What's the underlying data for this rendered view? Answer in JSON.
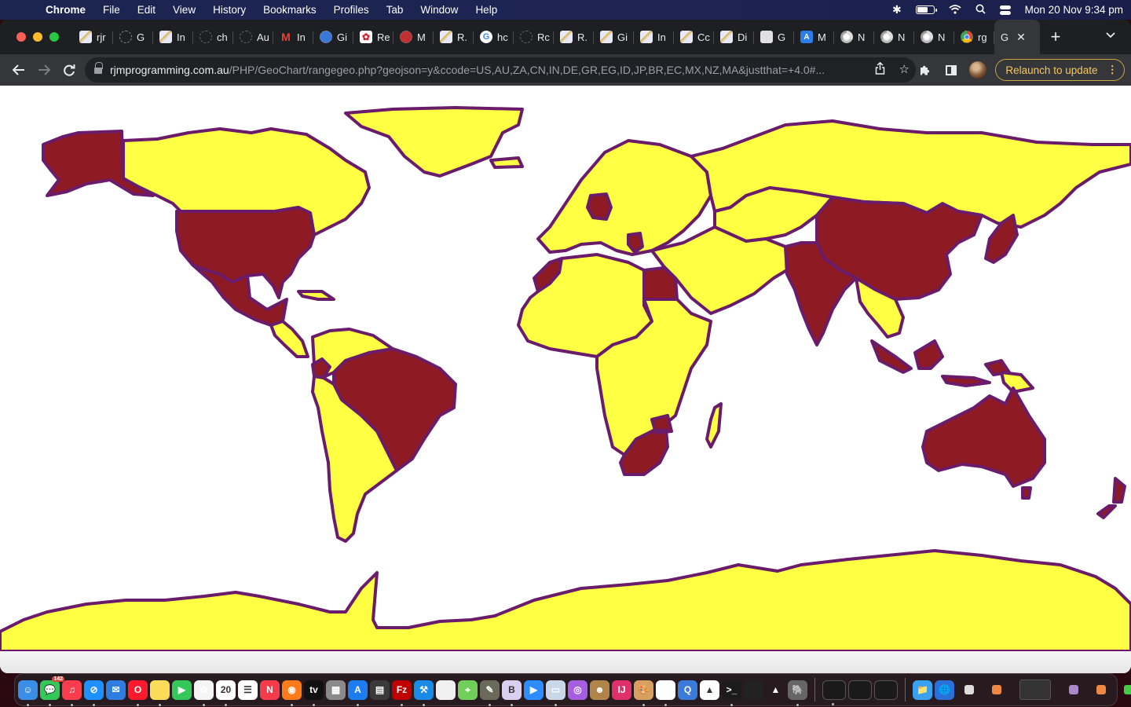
{
  "menubar": {
    "apple_icon": "apple-logo-icon",
    "app_name": "Chrome",
    "menus": [
      "File",
      "Edit",
      "View",
      "History",
      "Bookmarks",
      "Profiles",
      "Tab",
      "Window",
      "Help"
    ],
    "status_icons": [
      "bluetooth-icon",
      "battery-charging-icon",
      "wifi-icon",
      "spotlight-search-icon",
      "control-center-icon"
    ],
    "clock": "Mon 20 Nov  9:34 pm"
  },
  "window": {
    "tabs": [
      {
        "favicon": "rjm",
        "title": "rjr"
      },
      {
        "favicon": "ring",
        "title": "G"
      },
      {
        "favicon": "rjm",
        "title": "In"
      },
      {
        "favicon": "grey-ring",
        "title": "ch"
      },
      {
        "favicon": "grey-ring",
        "title": "Au"
      },
      {
        "favicon": "gmail",
        "title": "In"
      },
      {
        "favicon": "blue-ring",
        "title": "Gi"
      },
      {
        "favicon": "red-flower",
        "title": "Re"
      },
      {
        "favicon": "red-ring",
        "title": "M"
      },
      {
        "favicon": "rjm",
        "title": "R."
      },
      {
        "favicon": "google",
        "title": "hc"
      },
      {
        "favicon": "grey-ring",
        "title": "Rc"
      },
      {
        "favicon": "rjm",
        "title": "R."
      },
      {
        "favicon": "rjm",
        "title": "Gi"
      },
      {
        "favicon": "rjm",
        "title": "In"
      },
      {
        "favicon": "rjm",
        "title": "Cc"
      },
      {
        "favicon": "rjm",
        "title": "Di"
      },
      {
        "favicon": "folder",
        "title": "G"
      },
      {
        "favicon": "appstore",
        "title": "M"
      },
      {
        "favicon": "chrome",
        "title": "N"
      },
      {
        "favicon": "chrome",
        "title": "N"
      },
      {
        "favicon": "chrome",
        "title": "N"
      },
      {
        "favicon": "chrome-color",
        "title": "rg"
      }
    ],
    "active_tab": {
      "title": "G",
      "close_icon": "close-icon"
    },
    "new_tab_label": "+",
    "tab_search_icon": "chevron-down-icon",
    "toolbar": {
      "back_icon": "back-arrow-icon",
      "forward_icon": "forward-arrow-icon",
      "reload_icon": "reload-icon",
      "url_host": "rjmprogramming.com.au",
      "url_path": "/PHP/GeoChart/rangegeo.php?geojson=y&ccode=US,AU,ZA,CN,IN,DE,GR,EG,ID,JP,BR,EC,MX,NZ,MA&justthat=+4.0#...",
      "share_icon": "share-icon",
      "bookmark_icon": "star-icon",
      "extensions_icon": "puzzle-piece-icon",
      "side_panel_icon": "side-panel-icon",
      "relaunch_label": "Relaunch to update",
      "menu_icon": "more-vertical-icon"
    }
  },
  "map": {
    "type": "geochart",
    "base_fill": "#ffff44",
    "highlight_fill": "#8e1b23",
    "border_color": "#6a1b6a",
    "highlighted_country_codes": [
      "US",
      "AU",
      "ZA",
      "CN",
      "IN",
      "DE",
      "GR",
      "EG",
      "ID",
      "JP",
      "BR",
      "EC",
      "MX",
      "NZ",
      "MA"
    ],
    "regions": [
      {
        "name": "Alaska (US)",
        "highlight": true
      },
      {
        "name": "Canada",
        "highlight": false
      },
      {
        "name": "Greenland",
        "highlight": false
      },
      {
        "name": "United States",
        "highlight": true
      },
      {
        "name": "Mexico",
        "highlight": true
      },
      {
        "name": "Central America",
        "highlight": false
      },
      {
        "name": "Cuba",
        "highlight": false
      },
      {
        "name": "Northern South America",
        "highlight": false
      },
      {
        "name": "Ecuador",
        "highlight": true
      },
      {
        "name": "Brazil",
        "highlight": true
      },
      {
        "name": "Southern South America",
        "highlight": false
      },
      {
        "name": "Europe",
        "highlight": false
      },
      {
        "name": "Iceland",
        "highlight": false
      },
      {
        "name": "Germany",
        "highlight": true
      },
      {
        "name": "Greece",
        "highlight": true
      },
      {
        "name": "Russia",
        "highlight": false
      },
      {
        "name": "Central Asia",
        "highlight": false
      },
      {
        "name": "Middle East",
        "highlight": false
      },
      {
        "name": "China",
        "highlight": true
      },
      {
        "name": "India",
        "highlight": true
      },
      {
        "name": "Southeast Asia",
        "highlight": false
      },
      {
        "name": "Japan",
        "highlight": true
      },
      {
        "name": "Indonesia",
        "highlight": true
      },
      {
        "name": "Papua New Guinea",
        "highlight": false
      },
      {
        "name": "Morocco",
        "highlight": true
      },
      {
        "name": "Northwest Africa",
        "highlight": false
      },
      {
        "name": "Egypt",
        "highlight": true
      },
      {
        "name": "Central Africa",
        "highlight": false
      },
      {
        "name": "South Africa",
        "highlight": true
      },
      {
        "name": "Madagascar",
        "highlight": false
      },
      {
        "name": "Australia",
        "highlight": true
      },
      {
        "name": "New Zealand",
        "highlight": true
      },
      {
        "name": "Antarctica",
        "highlight": false
      }
    ]
  },
  "dock": {
    "apps": [
      {
        "name": "finder",
        "glyph": "☺",
        "bg": "#3a8ee6",
        "running": true
      },
      {
        "name": "messages",
        "glyph": "💬",
        "bg": "#34c759",
        "running": true,
        "badge": "142"
      },
      {
        "name": "music",
        "glyph": "♫",
        "bg": "#fa3c4c",
        "running": true
      },
      {
        "name": "safari",
        "glyph": "⊘",
        "bg": "#1e90ff",
        "running": true
      },
      {
        "name": "mail",
        "glyph": "✉",
        "bg": "#2f7de1",
        "running": false
      },
      {
        "name": "opera",
        "glyph": "O",
        "bg": "#ff1b2d",
        "running": true
      },
      {
        "name": "notes",
        "glyph": "",
        "bg": "#fddb5a",
        "running": true
      },
      {
        "name": "facetime",
        "glyph": "▶",
        "bg": "#34c759",
        "running": false
      },
      {
        "name": "photos",
        "glyph": "✿",
        "bg": "#f5f5f5",
        "running": true
      },
      {
        "name": "calendar",
        "glyph": "20",
        "bg": "#ffffff",
        "running": true
      },
      {
        "name": "reminders",
        "glyph": "☰",
        "bg": "#ffffff",
        "running": false
      },
      {
        "name": "news",
        "glyph": "N",
        "bg": "#f43a4b",
        "running": false
      },
      {
        "name": "firefox",
        "glyph": "◉",
        "bg": "#ff7a1a",
        "running": true
      },
      {
        "name": "apple-tv",
        "glyph": "tv",
        "bg": "#111111",
        "running": true
      },
      {
        "name": "launchpad",
        "glyph": "▦",
        "bg": "#8a8a8a",
        "running": false
      },
      {
        "name": "app-store",
        "glyph": "A",
        "bg": "#1c7cf0",
        "running": true
      },
      {
        "name": "calculator",
        "glyph": "▤",
        "bg": "#3a3a3a",
        "running": false
      },
      {
        "name": "filezilla",
        "glyph": "Fz",
        "bg": "#bf0000",
        "running": true
      },
      {
        "name": "xcode",
        "glyph": "⚒",
        "bg": "#1a8ae8",
        "running": true
      },
      {
        "name": "libreoffice",
        "glyph": "",
        "bg": "#f0f0f0",
        "running": false
      },
      {
        "name": "maps",
        "glyph": "⌖",
        "bg": "#6fcf5a",
        "running": false
      },
      {
        "name": "gimp",
        "glyph": "✎",
        "bg": "#6a6a5a",
        "running": true
      },
      {
        "name": "bbedit",
        "glyph": "B",
        "bg": "#d8d0f0",
        "running": true
      },
      {
        "name": "zoom",
        "glyph": "▶",
        "bg": "#2d8cff",
        "running": false
      },
      {
        "name": "preview",
        "glyph": "▭",
        "bg": "#c8d8e8",
        "running": true
      },
      {
        "name": "podcasts",
        "glyph": "◎",
        "bg": "#a65ee0",
        "running": false
      },
      {
        "name": "contacts",
        "glyph": "☻",
        "bg": "#b0854a",
        "running": false
      },
      {
        "name": "intellij",
        "glyph": "IJ",
        "bg": "#e0306a",
        "running": false
      },
      {
        "name": "paintbrush",
        "glyph": "🎨",
        "bg": "#d8a060",
        "running": true
      },
      {
        "name": "chrome",
        "glyph": "◉",
        "bg": "#ffffff",
        "running": true
      },
      {
        "name": "quicktime",
        "glyph": "Q",
        "bg": "#3a7ad8",
        "running": false
      },
      {
        "name": "inkscape",
        "glyph": "▲",
        "bg": "#ffffff",
        "running": false
      },
      {
        "name": "terminal",
        "glyph": ">_",
        "bg": "#1c1c1c",
        "running": true
      },
      {
        "name": "console",
        "glyph": "",
        "bg": "#222222",
        "running": false
      },
      {
        "name": "delta-app",
        "glyph": "▲",
        "bg": "transparent",
        "running": false
      },
      {
        "name": "mamp",
        "glyph": "🐘",
        "bg": "#666666",
        "running": true
      }
    ],
    "minimized": [
      {
        "name": "terminal-window-1",
        "running": true
      },
      {
        "name": "terminal-window-2",
        "running": false
      },
      {
        "name": "terminal-window-3",
        "running": false
      }
    ],
    "folders": [
      {
        "name": "downloads-folder",
        "glyph": "📁",
        "bg": "#3aa0f0"
      },
      {
        "name": "network-globe",
        "glyph": "🌐",
        "bg": "#2a70d8"
      }
    ],
    "trash_icon": "trash-icon"
  }
}
